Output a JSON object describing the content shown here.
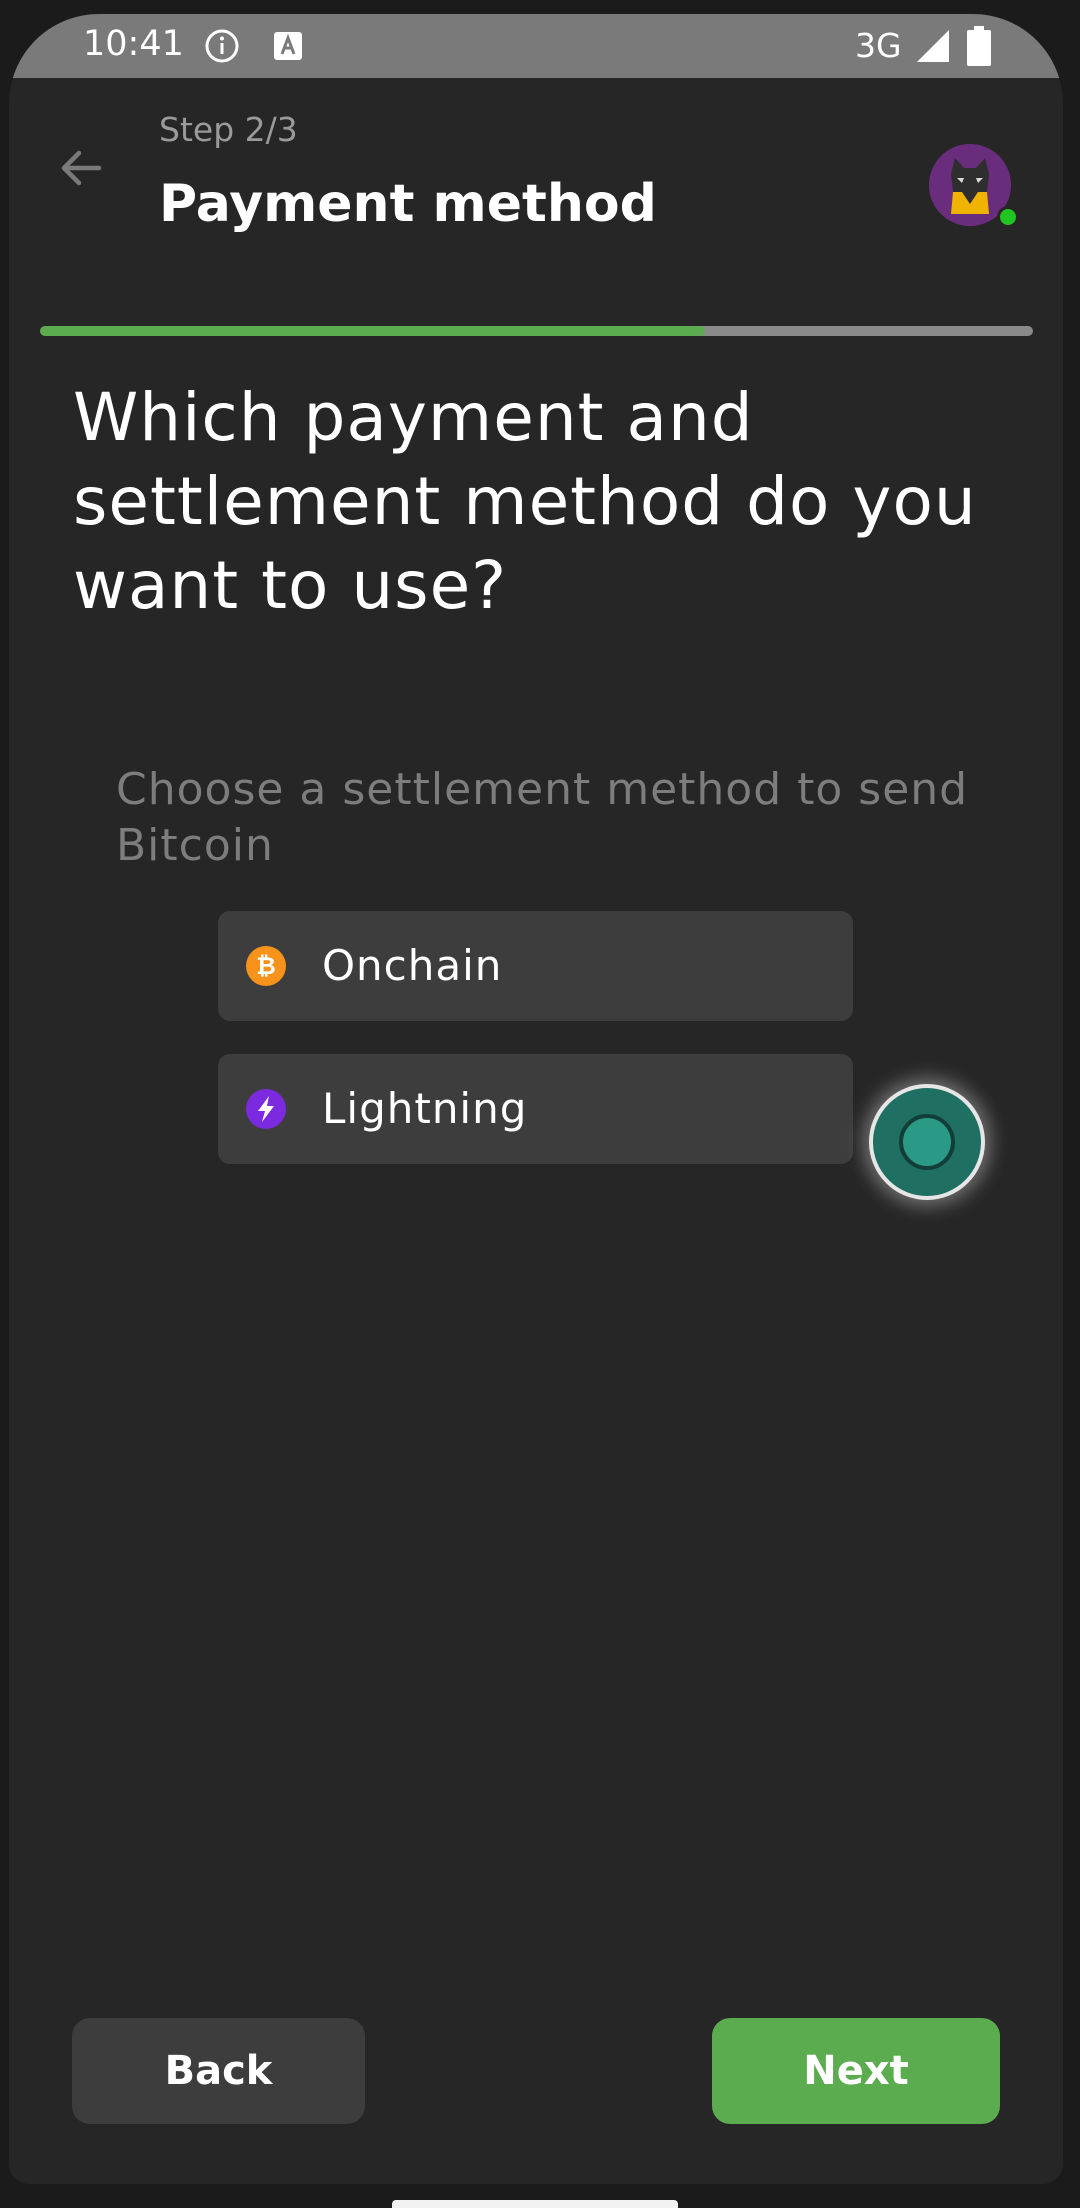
{
  "status_bar": {
    "time": "10:41",
    "network": "3G",
    "icons": [
      "info-icon",
      "a-icon",
      "signal-icon",
      "battery-icon"
    ]
  },
  "header": {
    "step": "Step 2/3",
    "title": "Payment method",
    "back_icon": "arrow-left-icon",
    "avatar_icon": "cat-avatar-icon"
  },
  "progress": {
    "fraction": 0.67,
    "fill_color": "#5aac4e",
    "track_color": "#8a8a8a"
  },
  "main": {
    "question": "Which payment and settlement method do you want to use?",
    "helper": "Choose a settlement method to send Bitcoin",
    "options": [
      {
        "label": "Onchain",
        "icon": "bitcoin-icon",
        "icon_color": "#f7931a"
      },
      {
        "label": "Lightning",
        "icon": "lightning-icon",
        "icon_color": "#7b2ae0"
      }
    ]
  },
  "footer": {
    "back_label": "Back",
    "next_label": "Next"
  },
  "colors": {
    "background": "#262626",
    "accent": "#5aac4e",
    "card": "#3d3d3d"
  }
}
